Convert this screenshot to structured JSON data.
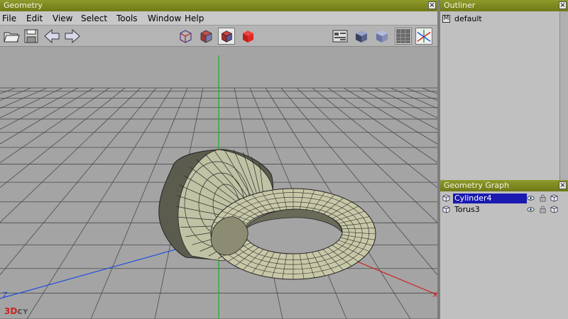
{
  "geometry_window": {
    "title": "Geometry",
    "close_glyph": "×"
  },
  "menu": [
    "File",
    "Edit",
    "View",
    "Select",
    "Tools",
    "Window",
    "Help"
  ],
  "toolbar": {
    "left": [
      "open-folder-icon",
      "save-disk-icon",
      "back-arrow-icon",
      "forward-arrow-icon"
    ],
    "shading_modes": [
      "wireframe-cube-icon",
      "smooth-wire-cube-icon",
      "flat-wire-cube-icon",
      "solid-red-cube-icon"
    ],
    "active_shading": "flat-wire-cube-icon",
    "right": [
      "render-settings-icon",
      "smooth-shaded-cube-icon",
      "flat-shaded-cube-icon",
      "grid-toggle-icon",
      "axes-toggle-icon"
    ]
  },
  "viewport": {
    "axis_x_label": "X",
    "axis_z_label": "Z"
  },
  "outliner": {
    "title": "Outliner",
    "close_glyph": "×",
    "items": [
      {
        "badge": "M",
        "label": "default"
      }
    ]
  },
  "geometry_graph": {
    "title": "Geometry Graph",
    "close_glyph": "×",
    "items": [
      {
        "label": "Cylinder4",
        "selected": true
      },
      {
        "label": "Torus3",
        "selected": false
      }
    ]
  },
  "logo": {
    "prefix": "3D",
    "suffix": "ᴄʏ"
  },
  "colors": {
    "title_bar": "#7e8a1e",
    "mesh_fill": "#c8c8a8",
    "selection": "#1a1ab0",
    "axis_x": "#d02020",
    "axis_y": "#20b020",
    "axis_z": "#2050e0"
  }
}
